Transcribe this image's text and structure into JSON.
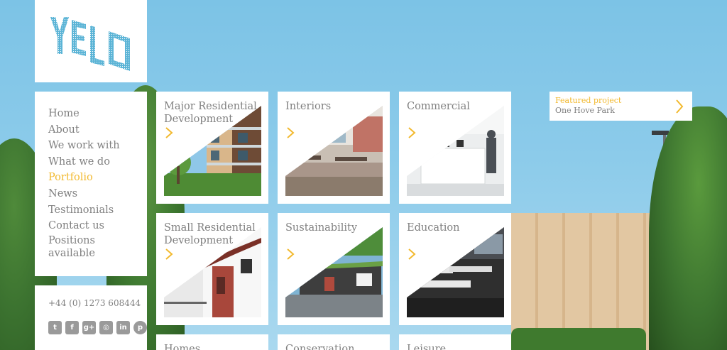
{
  "brand": {
    "logo_text": "YELO"
  },
  "nav": {
    "items": [
      {
        "label": "Home"
      },
      {
        "label": "About"
      },
      {
        "label": "We work with"
      },
      {
        "label": "What we do"
      },
      {
        "label": "Portfolio",
        "active": true
      },
      {
        "label": "News"
      },
      {
        "label": "Testimonials"
      },
      {
        "label": "Contact us"
      },
      {
        "label_line1": "Positions",
        "label_line2": "available"
      }
    ]
  },
  "contact": {
    "phone": "+44 (0) 1273 608444",
    "social": [
      "twitter-icon",
      "facebook-icon",
      "google-plus-icon",
      "instagram-icon",
      "linkedin-icon",
      "pinterest-icon"
    ]
  },
  "tiles": [
    {
      "title": "Major Residential Development"
    },
    {
      "title": "Interiors"
    },
    {
      "title": "Commercial"
    },
    {
      "title": "Small Residential Development"
    },
    {
      "title": "Sustainability"
    },
    {
      "title": "Education"
    },
    {
      "title": "Homes"
    },
    {
      "title": "Conservation"
    },
    {
      "title": "Leisure"
    }
  ],
  "featured": {
    "label": "Featured project",
    "name": "One Hove Park"
  },
  "colors": {
    "accent": "#f2b92e",
    "text": "#808080",
    "logo": "#5bb4d6",
    "sky": "#8ccbea"
  }
}
